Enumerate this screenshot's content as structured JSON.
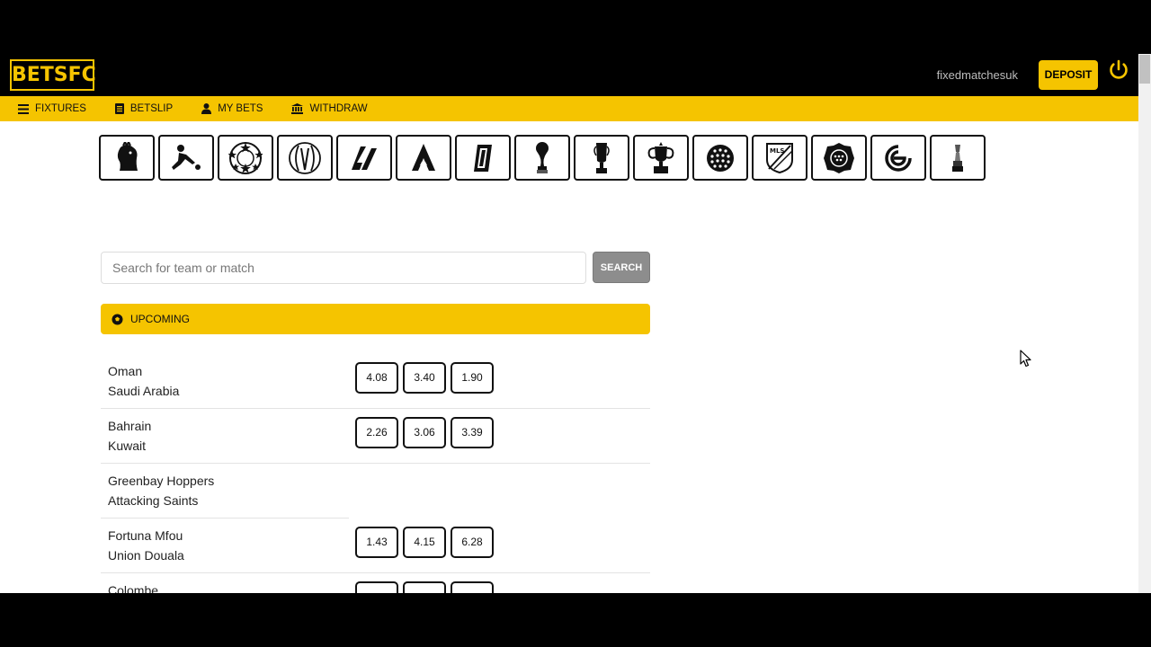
{
  "brand": {
    "logo_text": "BETSFC",
    "accent": "#f5c400"
  },
  "header": {
    "username": "fixedmatchesuk",
    "deposit_label": "DEPOSIT",
    "power_icon": "power-icon"
  },
  "nav": {
    "items": [
      {
        "label": "FIXTURES",
        "icon": "menu-icon"
      },
      {
        "label": "BETSLIP",
        "icon": "document-icon"
      },
      {
        "label": "MY BETS",
        "icon": "user-icon"
      },
      {
        "label": "WITHDRAW",
        "icon": "bank-icon"
      }
    ]
  },
  "leagues": [
    {
      "icon": "premier-league-icon"
    },
    {
      "icon": "bundesliga-icon"
    },
    {
      "icon": "champions-league-icon"
    },
    {
      "icon": "conference-league-icon"
    },
    {
      "icon": "laliga-icon"
    },
    {
      "icon": "serie-a-icon"
    },
    {
      "icon": "ligue-1-icon"
    },
    {
      "icon": "world-cup-icon"
    },
    {
      "icon": "euro-trophy-icon"
    },
    {
      "icon": "fa-cup-icon"
    },
    {
      "icon": "ball-icon"
    },
    {
      "icon": "mls-icon"
    },
    {
      "icon": "efl-icon"
    },
    {
      "icon": "eredivisie-icon"
    },
    {
      "icon": "copa-trophy-icon"
    }
  ],
  "search": {
    "placeholder": "Search for team or match",
    "button_label": "SEARCH"
  },
  "section": {
    "title": "UPCOMING"
  },
  "matches": [
    {
      "home": "Oman",
      "away": "Saudi Arabia",
      "odds": [
        "4.08",
        "3.40",
        "1.90"
      ]
    },
    {
      "home": "Bahrain",
      "away": "Kuwait",
      "odds": [
        "2.26",
        "3.06",
        "3.39"
      ]
    },
    {
      "home": "Greenbay Hoppers",
      "away": "Attacking Saints",
      "odds": []
    },
    {
      "home": "Fortuna Mfou",
      "away": "Union Douala",
      "odds": [
        "1.43",
        "4.15",
        "6.28"
      ]
    },
    {
      "home": "Colombe",
      "away": "",
      "odds": [
        "",
        "",
        ""
      ]
    }
  ]
}
